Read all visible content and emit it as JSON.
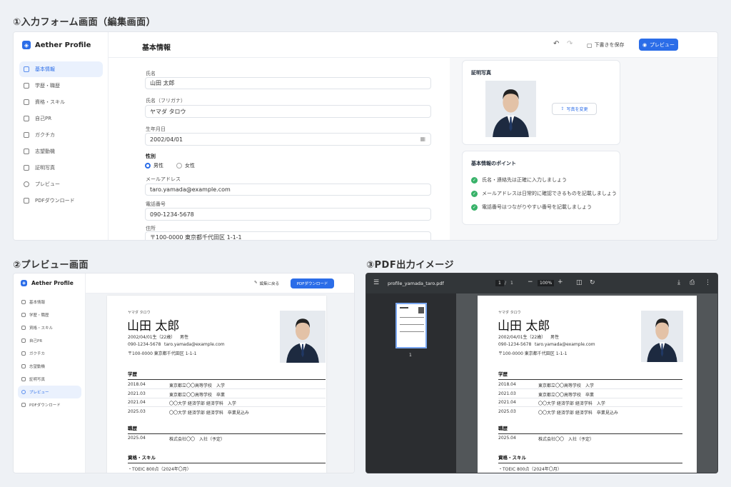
{
  "sections": {
    "edit": "①入力フォーム画面（編集画面）",
    "preview": "②プレビュー画面",
    "pdf": "③PDF出力イメージ"
  },
  "app": {
    "name": "Aether Profile"
  },
  "nav": {
    "items": [
      "基本情報",
      "学歴・職歴",
      "資格・スキル",
      "自己PR",
      "ガクチカ",
      "志望動機",
      "証明写真",
      "プレビュー",
      "PDFダウンロード"
    ]
  },
  "edit": {
    "page_title": "基本情報",
    "save_draft": "下書きを保存",
    "preview_btn": "プレビュー",
    "fields": {
      "name_label": "氏名",
      "name_value": "山田 太郎",
      "kana_label": "氏名（フリガナ）",
      "kana_value": "ヤマダ タロウ",
      "birth_label": "生年月日",
      "birth_value": "2002/04/01",
      "gender_label": "性別",
      "gender_male": "男性",
      "gender_female": "女性",
      "email_label": "メールアドレス",
      "email_value": "taro.yamada@example.com",
      "phone_label": "電話番号",
      "phone_value": "090-1234-5678",
      "address_label": "住所",
      "address_value": "〒100-0000 東京都千代田区 1-1-1"
    },
    "photo_card": {
      "title": "証明写真",
      "change_btn": "写真を変更"
    },
    "tips_card": {
      "title": "基本情報のポイント",
      "tips": [
        "氏名・連絡先は正確に入力しましょう",
        "メールアドレスは日常的に確認できるものを記載しましょう",
        "電話番号はつながりやすい番号を記載しましょう"
      ]
    }
  },
  "preview": {
    "back_btn": "編集に戻る",
    "pdf_btn": "PDFダウンロード"
  },
  "resume": {
    "kana": "ヤマダ タロウ",
    "name": "山田 太郎",
    "birth": "2002/04/01生（22歳）",
    "gender": "男性",
    "phone": "090-1234-5678",
    "email": "taro.yamada@example.com",
    "address": "〒100-0000 東京都千代田区 1-1-1",
    "edu_head": "学歴",
    "edu": [
      {
        "date": "2018.04",
        "text": "東京都立〇〇高等学校　入学"
      },
      {
        "date": "2021.03",
        "text": "東京都立〇〇高等学校　卒業"
      },
      {
        "date": "2021.04",
        "text": "〇〇大学 経済学部 経済学科　入学"
      },
      {
        "date": "2025.03",
        "text": "〇〇大学 経済学部 経済学科　卒業見込み"
      }
    ],
    "work_head": "職歴",
    "work": [
      {
        "date": "2025.04",
        "text": "株式会社〇〇　入社（予定）"
      }
    ],
    "skill_head": "資格・スキル",
    "skills": [
      "・TOEIC 800点（2024年〇月）"
    ]
  },
  "pdf": {
    "filename": "profile_yamada_taro.pdf",
    "page_current": "1",
    "page_sep": "/",
    "page_total": "1",
    "zoom": "100%",
    "thumb_label": "1"
  }
}
